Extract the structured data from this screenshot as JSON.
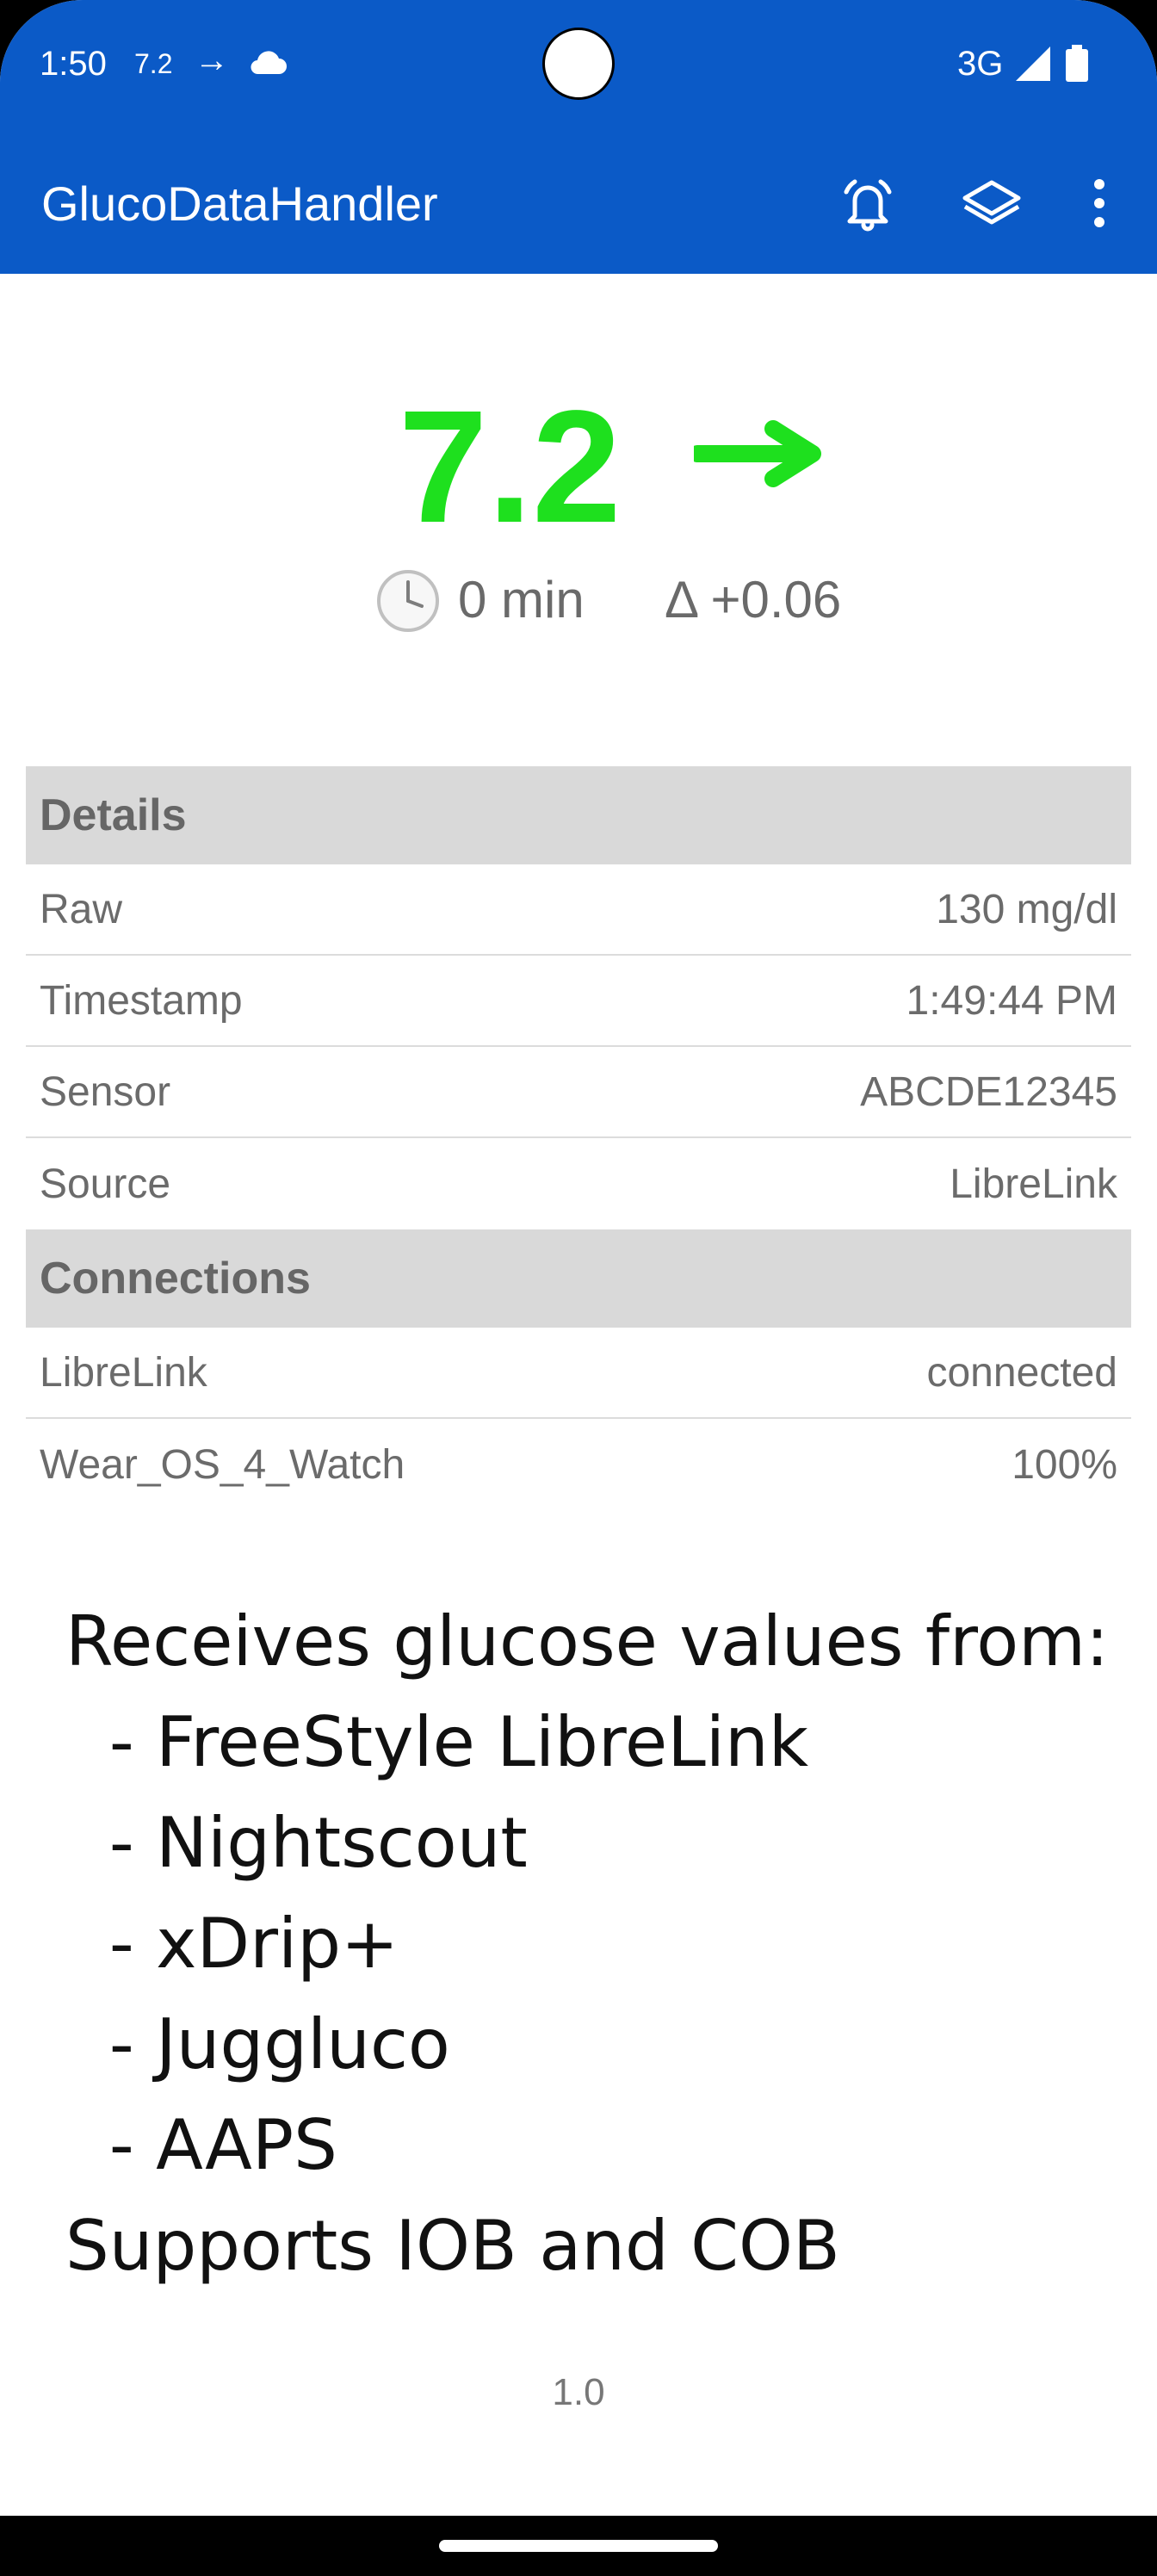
{
  "status_bar": {
    "time": "1:50",
    "glucose_mini": "7.2",
    "trend_mini": "→",
    "network": "3G"
  },
  "toolbar": {
    "title": "GlucoDataHandler",
    "icons": [
      "bell-icon",
      "layers-icon",
      "more-vert-icon"
    ]
  },
  "glucose": {
    "value": "7.2",
    "trend": "→",
    "color": "#1ee01e",
    "age_icon": "🕒",
    "age": "0 min",
    "delta": "Δ +0.06"
  },
  "details": {
    "header": "Details",
    "rows": [
      {
        "label": "Raw",
        "value": "130 mg/dl"
      },
      {
        "label": "Timestamp",
        "value": "1:49:44 PM"
      },
      {
        "label": "Sensor",
        "value": "ABCDE12345"
      },
      {
        "label": "Source",
        "value": "LibreLink"
      }
    ]
  },
  "connections": {
    "header": "Connections",
    "rows": [
      {
        "label": "LibreLink",
        "value": "connected"
      },
      {
        "label": "Wear_OS_4_Watch",
        "value": "100%"
      }
    ]
  },
  "info_text": "Receives glucose values from:\n  - FreeStyle LibreLink\n  - Nightscout\n  - xDrip+\n  - Juggluco\n  - AAPS\nSupports IOB and COB",
  "version": "1.0"
}
